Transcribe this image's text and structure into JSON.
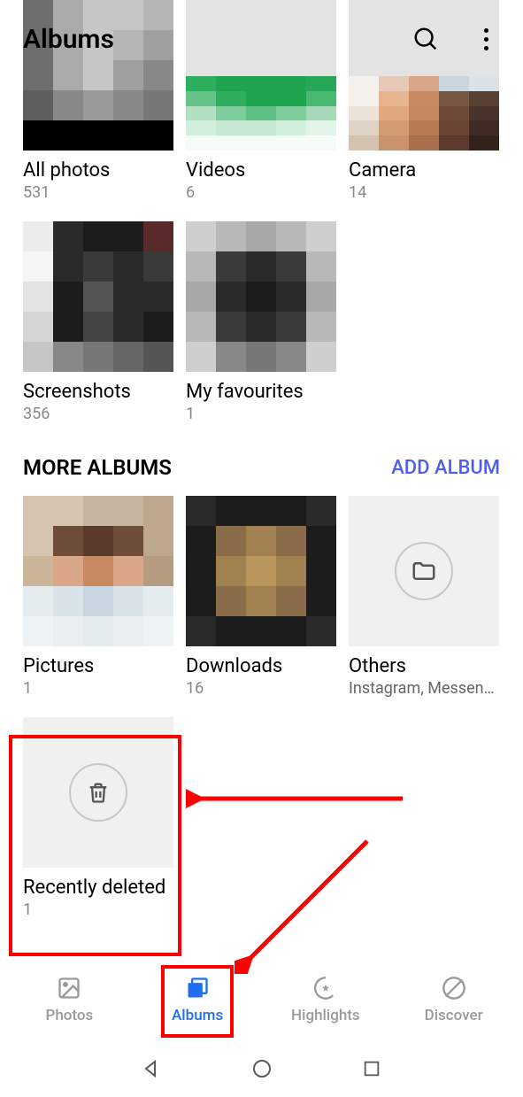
{
  "header": {
    "title": "Albums"
  },
  "albums_main": [
    {
      "title": "All photos",
      "count": "531"
    },
    {
      "title": "Videos",
      "count": "6"
    },
    {
      "title": "Camera",
      "count": "14"
    },
    {
      "title": "Screenshots",
      "count": "356"
    },
    {
      "title": "My favourites",
      "count": "1"
    }
  ],
  "more_section": {
    "title": "MORE ALBUMS",
    "add_label": "ADD ALBUM"
  },
  "albums_more": [
    {
      "title": "Pictures",
      "count": "1"
    },
    {
      "title": "Downloads",
      "count": "16"
    },
    {
      "title": "Others",
      "sub": "Instagram, Messenge…"
    },
    {
      "title": "Recently deleted",
      "count": "1"
    }
  ],
  "bottom_nav": {
    "photos": "Photos",
    "albums": "Albums",
    "highlights": "Highlights",
    "discover": "Discover"
  }
}
